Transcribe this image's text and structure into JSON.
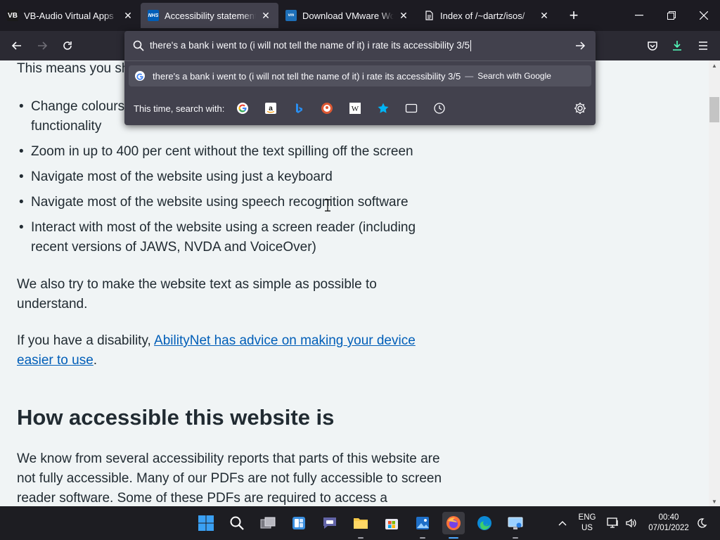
{
  "tabs": [
    {
      "title": "VB-Audio Virtual Apps",
      "favicon": "VB",
      "active": false
    },
    {
      "title": "Accessibility statement - NHS",
      "favicon": "NHS",
      "active": true
    },
    {
      "title": "Download VMware Workstation",
      "favicon": "vm",
      "active": false
    },
    {
      "title": "Index of /~dartz/isos/",
      "favicon": "doc",
      "active": false
    }
  ],
  "urlbar": {
    "value": "there's a bank i went to (i will not tell the name of it) i rate its accessibility 3/5",
    "suggestion_text": "there's a bank i went to (i will not tell the name of it) i rate its accessibility 3/5",
    "suggestion_sep": "—",
    "suggestion_action": "Search with Google",
    "oneoff_label": "This time, search with:",
    "engines": [
      "google-icon",
      "amazon-icon",
      "bing-icon",
      "duckduckgo-icon",
      "wikipedia-icon",
      "bookmarks-icon",
      "tabs-icon",
      "history-icon"
    ]
  },
  "page": {
    "intro_partial": "This means you sh",
    "bullets": [
      "Change colours",
      "functionality",
      "Zoom in up to 400 per cent without the text spilling off the screen",
      "Navigate most of the website using just a keyboard",
      "Navigate most of the website using speech recognition software",
      "Interact with most of the website using a screen reader (including recent versions of JAWS, NVDA and VoiceOver)"
    ],
    "simple_text": "We also try to make the website text as simple as possible to understand.",
    "disability_prefix": "If you have a disability, ",
    "disability_link": "AbilityNet has advice on making your device easier to use",
    "disability_suffix": ".",
    "heading": "How accessible this website is",
    "body_text": "We know from several accessibility reports that parts of this website are not fully accessible. Many of our PDFs are not fully accessible to screen reader software. Some of these PDFs are required to access a"
  },
  "tray": {
    "lang_top": "ENG",
    "lang_bottom": "US",
    "time": "00:40",
    "date": "07/01/2022"
  },
  "colors": {
    "tabstrip": "#1c1b22",
    "toolbar": "#2b2a33",
    "urlpanel": "#42414d",
    "page_bg": "#f0f4f5",
    "text": "#212b32",
    "link": "#005eb8",
    "download_accent": "#54ffbd"
  }
}
